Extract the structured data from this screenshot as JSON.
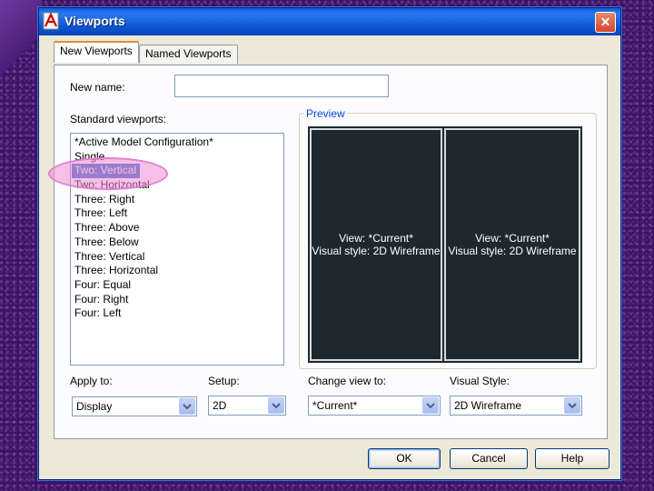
{
  "window": {
    "title": "Viewports"
  },
  "tabs": [
    {
      "label": "New Viewports"
    },
    {
      "label": "Named Viewports"
    }
  ],
  "new_name": {
    "label": "New name:",
    "value": ""
  },
  "standard_viewports": {
    "label": "Standard viewports:",
    "items": [
      "*Active Model Configuration*",
      "Single",
      "Two:  Vertical",
      "Two:  Horizontal",
      "Three: Right",
      "Three: Left",
      "Three: Above",
      "Three: Below",
      "Three: Vertical",
      "Three: Horizontal",
      "Four:  Equal",
      "Four:  Right",
      "Four:  Left"
    ],
    "selected_index": 2
  },
  "preview": {
    "title": "Preview",
    "panes": [
      {
        "view": "View: *Current*",
        "style": "Visual style: 2D Wireframe"
      },
      {
        "view": "View: *Current*",
        "style": "Visual style: 2D Wireframe"
      }
    ]
  },
  "apply_to": {
    "label": "Apply to:",
    "value": "Display"
  },
  "setup": {
    "label": "Setup:",
    "value": "2D"
  },
  "change_view_to": {
    "label": "Change view to:",
    "value": "*Current*"
  },
  "visual_style": {
    "label": "Visual Style:",
    "value": "2D Wireframe"
  },
  "buttons": {
    "ok": "OK",
    "cancel": "Cancel",
    "help": "Help"
  },
  "colors": {
    "accent": "#0046d5",
    "selection": "#316ac5",
    "preview_bg": "#1e2830",
    "highlight_ellipse": "#e37fd1"
  }
}
